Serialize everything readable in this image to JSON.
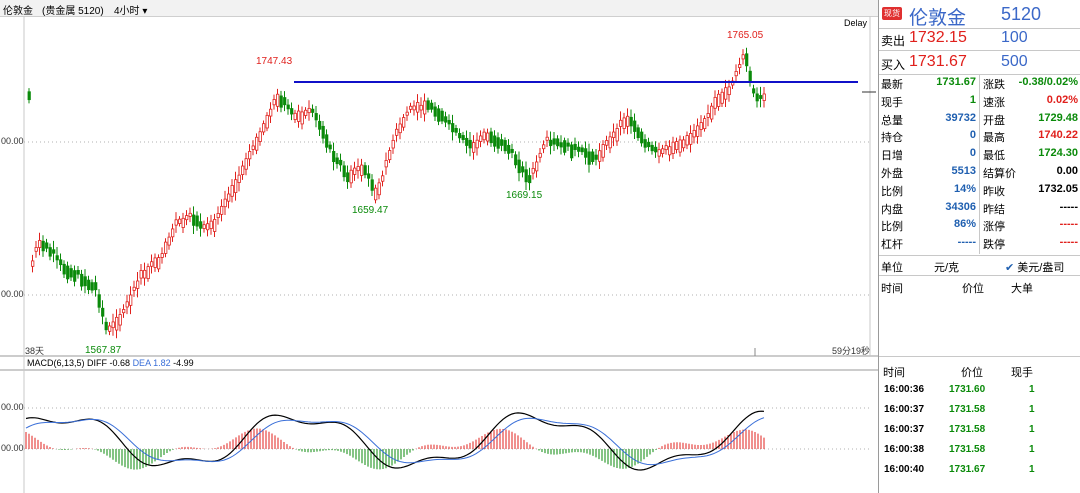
{
  "topbar": {
    "name": "伦敦金",
    "market": "(贵金属 5120)",
    "period": "4小时",
    "delay": "Delay"
  },
  "chart": {
    "price_labels": {
      "high1": "1747.43",
      "high2": "1765.05",
      "low1": "1659.47",
      "low2": "1669.15",
      "low0": "1567.87"
    },
    "yaxis": {
      "t1": "00.00",
      "t2": "00.00"
    },
    "bottom_left": "38天",
    "bottom_right": "59分19秒",
    "resistance_color": "#1010c8"
  },
  "macd": {
    "label": "MACD(6,13,5)",
    "diff": "DIFF -0.68",
    "dea": "DEA 1.82",
    "macd": "-4.99",
    "yaxis": {
      "t1": "00.00",
      "t2": "00.00"
    }
  },
  "panel": {
    "badge": "现货",
    "name": "伦敦金",
    "code": "5120",
    "sell_label": "卖出",
    "sell_price": "1732.15",
    "sell_qty": "100",
    "buy_label": "买入",
    "buy_price": "1731.67",
    "buy_qty": "500",
    "stats": [
      {
        "l1": "最新",
        "v1": "1731.67",
        "c1": "green",
        "l2": "涨跌",
        "v2": "-0.38/0.02%",
        "c2": "green"
      },
      {
        "l1": "现手",
        "v1": "1",
        "c1": "green",
        "l2": "速涨",
        "v2": "0.02%",
        "c2": "red"
      },
      {
        "l1": "总量",
        "v1": "39732",
        "c1": "blue",
        "l2": "开盘",
        "v2": "1729.48",
        "c2": "green"
      },
      {
        "l1": "持仓",
        "v1": "0",
        "c1": "blue",
        "l2": "最高",
        "v2": "1740.22",
        "c2": "red"
      },
      {
        "l1": "日增",
        "v1": "0",
        "c1": "blue",
        "l2": "最低",
        "v2": "1724.30",
        "c2": "green"
      },
      {
        "l1": "外盘",
        "v1": "5513",
        "c1": "blue",
        "l2": "结算价",
        "v2": "0.00",
        "c2": "black"
      },
      {
        "l1": "比例",
        "v1": "14%",
        "c1": "blue",
        "l2": "昨收",
        "v2": "1732.05",
        "c2": "black"
      },
      {
        "l1": "内盘",
        "v1": "34306",
        "c1": "blue",
        "l2": "昨结",
        "v2": "-----",
        "c2": "black"
      },
      {
        "l1": "比例",
        "v1": "86%",
        "c1": "blue",
        "l2": "涨停",
        "v2": "-----",
        "c2": "red"
      },
      {
        "l1": "杠杆",
        "v1": "-----",
        "c1": "blue",
        "l2": "跌停",
        "v2": "-----",
        "c2": "red"
      }
    ],
    "unit_label": "单位",
    "unit_value": "元/克",
    "unit_alt": "美元/盎司",
    "trade_hdr": {
      "time": "时间",
      "price": "价位",
      "size": "大单"
    },
    "tick_hdr": {
      "time": "时间",
      "price": "价位",
      "size": "现手"
    },
    "ticks": [
      {
        "time": "16:00:36",
        "price": "1731.60",
        "size": "1"
      },
      {
        "time": "16:00:37",
        "price": "1731.58",
        "size": "1"
      },
      {
        "time": "16:00:37",
        "price": "1731.58",
        "size": "1"
      },
      {
        "time": "16:00:38",
        "price": "1731.58",
        "size": "1"
      },
      {
        "time": "16:00:40",
        "price": "1731.67",
        "size": "1"
      }
    ]
  }
}
